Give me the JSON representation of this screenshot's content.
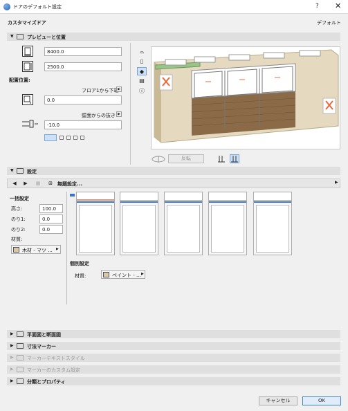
{
  "window": {
    "title": "ドアのデフォルト設定",
    "help": "?",
    "close": "✕"
  },
  "dialog": {
    "name": "カスタマイズドア",
    "default_label": "デフォルト"
  },
  "preview_section": {
    "title": "プレビューと位置",
    "width_value": "8400.0",
    "height_value": "2500.0",
    "placement_label": "配置位置:",
    "floor_offset_label": "フロア1から下端",
    "floor_offset_value": "0.0",
    "wall_offset_label": "壁面からの抜き",
    "wall_offset_value": "-10.0",
    "flip_label": "反転"
  },
  "settings_section": {
    "title": "設定",
    "dropdown_label": "無題設定...",
    "group_label": "一括設定",
    "height_label": "高さ:",
    "height_value": "100.0",
    "frame1_label": "のり1:",
    "frame1_value": "0.0",
    "frame2_label": "のり2:",
    "frame2_value": "0.0",
    "material_label": "材質:",
    "material_value": "木材 - マツ ...",
    "individual_label": "個別設定",
    "individual_material_label": "材質:",
    "individual_material_value": "ペイント - ...",
    "material_swatch_color": "#d9c7a8"
  },
  "collapsed_sections": [
    {
      "title": "平面図と断面図",
      "dim": false
    },
    {
      "title": "寸法マーカー",
      "dim": false
    },
    {
      "title": "マーカーテキストスタイル",
      "dim": true
    },
    {
      "title": "マーカーのカスタム設定",
      "dim": true
    },
    {
      "title": "分類とプロパティ",
      "dim": false
    }
  ],
  "buttons": {
    "cancel": "キャンセル",
    "ok": "OK"
  },
  "colors": {
    "accent": "#3b73c9",
    "wall": "#d8c9a5",
    "wood": "#8b6a48"
  }
}
